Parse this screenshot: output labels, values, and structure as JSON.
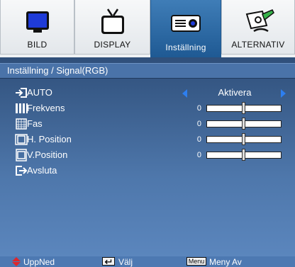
{
  "tabs": [
    {
      "label": "BILD",
      "icon": "monitor-icon",
      "active": false
    },
    {
      "label": "DISPLAY",
      "icon": "tv-icon",
      "active": false
    },
    {
      "label": "Inställning",
      "icon": "projector-icon",
      "active": true
    },
    {
      "label": "ALTERNATIV",
      "icon": "options-pencil-icon",
      "active": false
    }
  ],
  "panel": {
    "title": "Inställning / Signal(RGB)",
    "auto": {
      "label": "AUTO",
      "value": "Aktivera"
    },
    "items": [
      {
        "label": "Frekvens",
        "value": "0",
        "slider": 0.5
      },
      {
        "label": "Fas",
        "value": "0",
        "slider": 0.5
      },
      {
        "label": "H. Position",
        "value": "0",
        "slider": 0.5
      },
      {
        "label": "V.Position",
        "value": "0",
        "slider": 0.5
      }
    ],
    "exit": {
      "label": "Avsluta"
    }
  },
  "footer": {
    "updown": "UppNed",
    "select": "Välj",
    "menu_key": "Menu",
    "menu_off": "Meny Av"
  },
  "colors": {
    "accent_red": "#e0262b",
    "arrow_blue": "#2d7ff0",
    "panel_blue": "#4e77ab"
  }
}
